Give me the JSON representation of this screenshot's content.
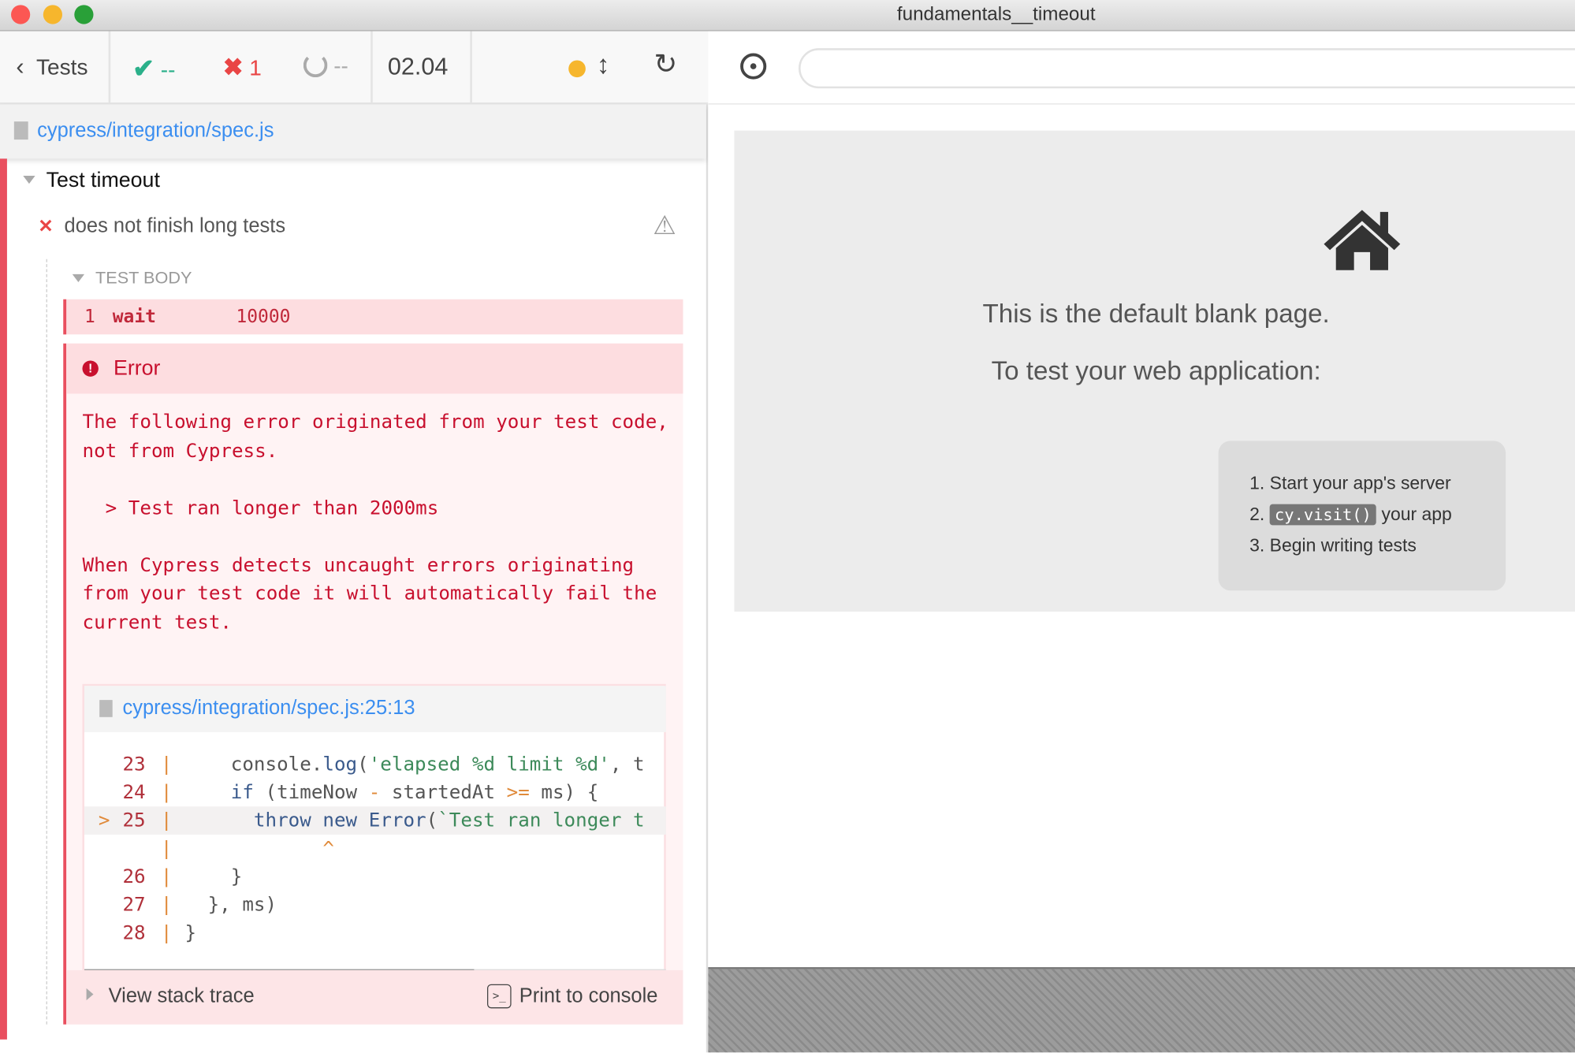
{
  "window": {
    "title": "fundamentals__timeout",
    "colors": {
      "close": "#fc5753",
      "minimize": "#f6b62d",
      "zoom": "#29a038"
    }
  },
  "reporter": {
    "back_label": "Tests",
    "stats": {
      "passed": "--",
      "failed": "1",
      "pending": "--"
    },
    "duration": "02.04",
    "status_dot_color": "#f6b62d",
    "spec_path": "cypress/integration/spec.js",
    "suite": {
      "title": "Test timeout"
    },
    "test": {
      "title": "does not finish long tests",
      "status": "failed"
    },
    "section_label": "TEST BODY",
    "command": {
      "number": "1",
      "name": "wait",
      "message": "10000"
    },
    "error": {
      "title": "Error",
      "message_lines": [
        "The following error originated from your test code,",
        "not from Cypress.",
        "",
        "  > Test ran longer than 2000ms",
        "",
        "When Cypress detects uncaught errors originating",
        "from your test code it will automatically fail the",
        "current test."
      ],
      "file_link": "cypress/integration/spec.js:25:13",
      "code": [
        {
          "num": "23",
          "marker": "",
          "hl": false,
          "seg": [
            [
              "    console.",
              ""
            ],
            [
              "log",
              "k"
            ],
            [
              "(",
              ""
            ],
            [
              "'elapsed %d limit %d'",
              "s"
            ],
            [
              ", t",
              ""
            ]
          ]
        },
        {
          "num": "24",
          "marker": "",
          "hl": false,
          "seg": [
            [
              "    ",
              ""
            ],
            [
              "if",
              "k"
            ],
            [
              " (timeNow ",
              ""
            ],
            [
              "-",
              "o"
            ],
            [
              " startedAt ",
              ""
            ],
            [
              ">=",
              "o"
            ],
            [
              " ms) {",
              ""
            ]
          ]
        },
        {
          "num": "25",
          "marker": ">",
          "hl": true,
          "seg": [
            [
              "      ",
              ""
            ],
            [
              "throw",
              "k"
            ],
            [
              " ",
              ""
            ],
            [
              "new",
              "k"
            ],
            [
              " ",
              ""
            ],
            [
              "Error",
              "k"
            ],
            [
              "(",
              ""
            ],
            [
              "`Test ran longer t",
              "s"
            ]
          ]
        },
        {
          "num": "",
          "marker": "",
          "hl": false,
          "seg": [
            [
              "            ",
              ""
            ],
            [
              "^",
              "o"
            ]
          ]
        },
        {
          "num": "26",
          "marker": "",
          "hl": false,
          "seg": [
            [
              "    }",
              ""
            ]
          ]
        },
        {
          "num": "27",
          "marker": "",
          "hl": false,
          "seg": [
            [
              "  }, ms)",
              ""
            ]
          ]
        },
        {
          "num": "28",
          "marker": "",
          "hl": false,
          "seg": [
            [
              "}",
              ""
            ]
          ]
        }
      ],
      "scroll_fraction": 0.67,
      "stack_trace_label": "View stack trace",
      "print_label": "Print to console"
    }
  },
  "aut": {
    "url": "",
    "heading": "This is the default blank page.",
    "subheading": "To test your web application:",
    "steps": [
      {
        "num": "1.",
        "text": "Start your app's server"
      },
      {
        "num": "2.",
        "code": "cy.visit()",
        "text": "your app"
      },
      {
        "num": "3.",
        "text": "Begin writing tests"
      }
    ]
  }
}
